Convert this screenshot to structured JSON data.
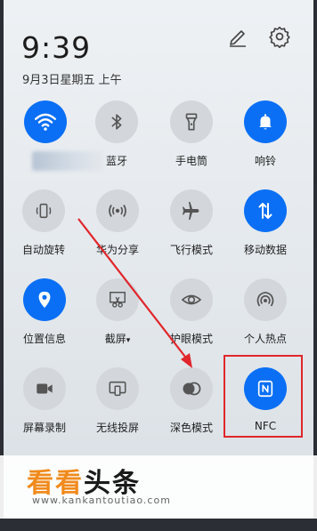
{
  "status": {
    "time": "9:39",
    "date": "9月3日星期五 上午"
  },
  "header_icons": [
    "edit-icon",
    "gear-icon"
  ],
  "tiles": [
    {
      "id": "wifi",
      "label": "",
      "icon": "wifi-icon",
      "active": true
    },
    {
      "id": "bluetooth",
      "label": "蓝牙",
      "icon": "bluetooth-icon",
      "active": false
    },
    {
      "id": "flashlight",
      "label": "手电筒",
      "icon": "flashlight-icon",
      "active": false
    },
    {
      "id": "ring",
      "label": "响铃",
      "icon": "bell-icon",
      "active": true
    },
    {
      "id": "auto-rotate",
      "label": "自动旋转",
      "icon": "rotate-icon",
      "active": false
    },
    {
      "id": "huawei-share",
      "label": "华为分享",
      "icon": "share-icon",
      "active": false
    },
    {
      "id": "airplane",
      "label": "飞行模式",
      "icon": "airplane-icon",
      "active": false
    },
    {
      "id": "mobile-data",
      "label": "移动数据",
      "icon": "data-arrows-icon",
      "active": true
    },
    {
      "id": "location",
      "label": "位置信息",
      "icon": "location-pin-icon",
      "active": true
    },
    {
      "id": "screenshot",
      "label": "截屏",
      "label_suffix": "▾",
      "icon": "screenshot-icon",
      "active": false
    },
    {
      "id": "eye-comfort",
      "label": "护眼模式",
      "icon": "eye-icon",
      "active": false
    },
    {
      "id": "hotspot",
      "label": "个人热点",
      "icon": "hotspot-icon",
      "active": false
    },
    {
      "id": "screen-record",
      "label": "屏幕录制",
      "icon": "video-camera-icon",
      "active": false
    },
    {
      "id": "wireless-projection",
      "label": "无线投屏",
      "icon": "cast-icon",
      "active": false
    },
    {
      "id": "dark-mode",
      "label": "深色模式",
      "icon": "dark-mode-icon",
      "active": false
    },
    {
      "id": "nfc",
      "label": "NFC",
      "icon": "nfc-icon",
      "active": true
    }
  ],
  "watermark": {
    "title_orange": "看看",
    "title_dark": "头条",
    "url": "www.kankantoutiao.com"
  },
  "colors": {
    "accent": "#0a6ff5",
    "inactive_tile": "#d3d7dc",
    "highlight": "#e0262b",
    "watermark_orange": "#f08a1c"
  }
}
